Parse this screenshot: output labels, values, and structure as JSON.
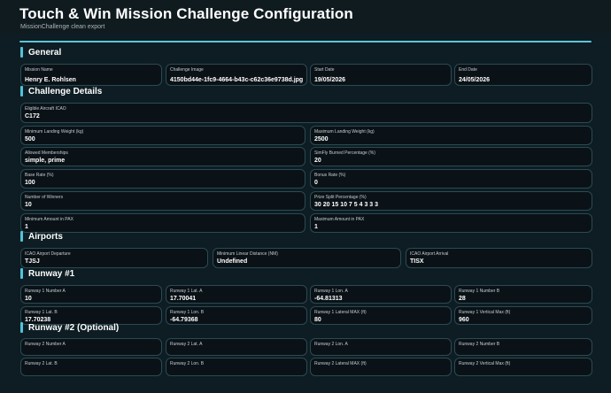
{
  "header": {
    "title": "Touch & Win Mission Challenge Configuration",
    "subtitle": "MissionChallenge clean export"
  },
  "theme": {
    "accent": "#52c3d9",
    "background": "#0d1d23",
    "field_border": "#2b4a52"
  },
  "sections": {
    "general": "General",
    "challenge_details": "Challenge Details",
    "airports": "Airports",
    "runway1": "Runway #1",
    "runway2": "Runway #2 (Optional)"
  },
  "general": {
    "mission_name": {
      "label": "Mission Name",
      "value": "Henry E. Rohlsen"
    },
    "challenge_image": {
      "label": "Challenge Image",
      "value": "4150bd44e-1fc9-4664-b43c-c62c36e9738d.jpg"
    },
    "start_date": {
      "label": "Start Date",
      "value": "19/05/2026"
    },
    "end_date": {
      "label": "End Date",
      "value": "24/05/2026"
    }
  },
  "details": {
    "eligible_aircraft": {
      "label": "Eligible Aircraft ICAO",
      "value": "C172"
    },
    "min_landing_weight": {
      "label": "Minimum Landing Weight (kg)",
      "value": "500"
    },
    "max_landing_weight": {
      "label": "Maximum Landing Weight (kg)",
      "value": "2500"
    },
    "allowed_memberships": {
      "label": "Allowed Memberships",
      "value": "simple, prime"
    },
    "simfly_burned": {
      "label": "SimFly Burned Percentage (%)",
      "value": "20"
    },
    "base_rate": {
      "label": "Base Rate (%)",
      "value": "100"
    },
    "bonus_rate": {
      "label": "Bonus Rate (%)",
      "value": "0"
    },
    "winners": {
      "label": "Number of Winners",
      "value": "10"
    },
    "prize_split": {
      "label": "Prize Split Percentage (%)",
      "value": "30 20 15 10 7 5 4 3 3 3"
    },
    "min_pax": {
      "label": "Minimum Amount in PAX",
      "value": "1"
    },
    "max_pax": {
      "label": "Maximum Amount in PAX",
      "value": "1"
    }
  },
  "airports": {
    "departure": {
      "label": "ICAO Airport Departure",
      "value": "TJSJ"
    },
    "min_distance": {
      "label": "Minimum Linear Distance (NM)",
      "value": "Undefined"
    },
    "arrival": {
      "label": "ICAO Airport Arrival",
      "value": "TISX"
    }
  },
  "runway1": {
    "number_a": {
      "label": "Runway 1 Number A",
      "value": "10"
    },
    "lat_a": {
      "label": "Runway 1 Lat. A",
      "value": "17.70041"
    },
    "lon_a": {
      "label": "Runway 1 Lon. A",
      "value": "-64.81313"
    },
    "number_b": {
      "label": "Runway 1 Number B",
      "value": "28"
    },
    "lat_b": {
      "label": "Runway 1 Lat. B",
      "value": "17.70238"
    },
    "lon_b": {
      "label": "Runway 1 Lon. B",
      "value": "-64.79368"
    },
    "lateral_max": {
      "label": "Runway 1 Lateral MAX (ft)",
      "value": "80"
    },
    "vertical_max": {
      "label": "Runway 1 Vertical Max (ft)",
      "value": "960"
    }
  },
  "runway2": {
    "number_a": {
      "label": "Runway 2 Number A",
      "value": ""
    },
    "lat_a": {
      "label": "Runway 2 Lat. A",
      "value": ""
    },
    "lon_a": {
      "label": "Runway 2 Lon. A",
      "value": ""
    },
    "number_b": {
      "label": "Runway 2 Number B",
      "value": ""
    },
    "lat_b": {
      "label": "Runway 2 Lat. B",
      "value": ""
    },
    "lon_b": {
      "label": "Runway 2 Lon. B",
      "value": ""
    },
    "lateral_max": {
      "label": "Runway 2 Lateral MAX (ft)",
      "value": ""
    },
    "vertical_max": {
      "label": "Runway 2 Vertical Max (ft)",
      "value": ""
    }
  }
}
